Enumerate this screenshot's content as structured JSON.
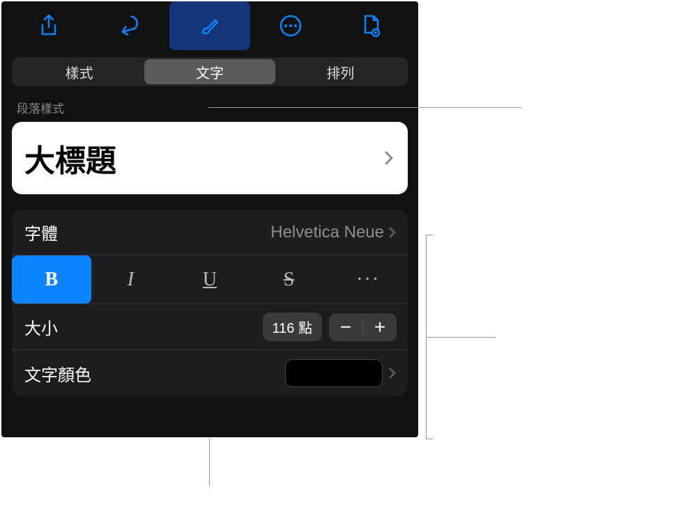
{
  "toolbar": {
    "icons": [
      "share",
      "undo",
      "brush",
      "more",
      "document"
    ]
  },
  "tabs": {
    "style": "樣式",
    "text": "文字",
    "arrange": "排列"
  },
  "section_paragraph_style": "段落樣式",
  "paragraph_style": {
    "value": "大標題"
  },
  "font": {
    "label": "字體",
    "value": "Helvetica Neue"
  },
  "style_buttons": {
    "bold": "B",
    "italic": "I",
    "underline": "U",
    "strike": "S",
    "more": "···"
  },
  "size": {
    "label": "大小",
    "value": "116 點",
    "minus": "−",
    "plus": "+"
  },
  "text_color": {
    "label": "文字顏色"
  }
}
